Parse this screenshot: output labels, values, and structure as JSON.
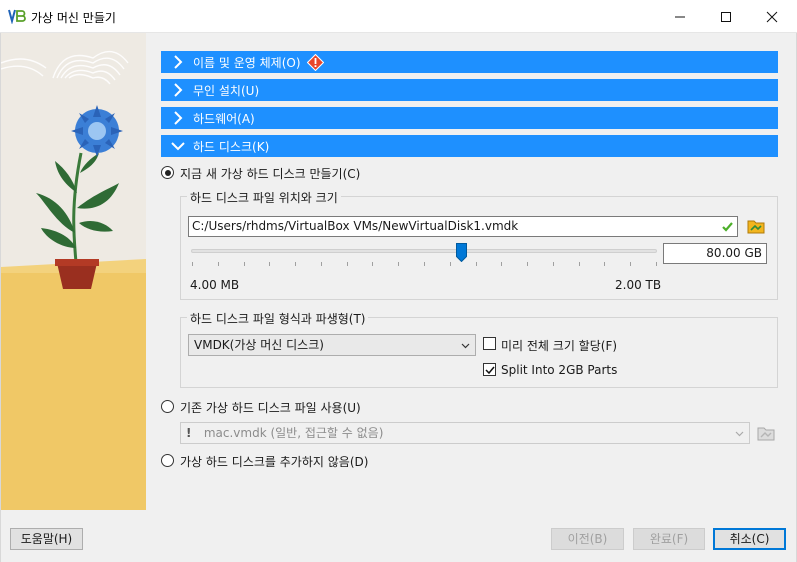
{
  "window": {
    "title": "가상 머신 만들기",
    "minimize_label": "Minimize",
    "maximize_label": "Maximize",
    "close_label": "Close"
  },
  "sections": [
    {
      "label": "이름 및 운영 체제(O)",
      "expanded": false,
      "warning": true
    },
    {
      "label": "무인 설치(U)",
      "expanded": false,
      "warning": false
    },
    {
      "label": "하드웨어(A)",
      "expanded": false,
      "warning": false
    },
    {
      "label": "하드 디스크(K)",
      "expanded": true,
      "warning": false
    }
  ],
  "disk": {
    "option_create": "지금 새 가상 하드 디스크 만들기(C)",
    "location_group": "하드 디스크 파일 위치와 크기",
    "path_value": "C:/Users/rhdms/VirtualBox VMs/NewVirtualDisk1.vmdk",
    "size_value": "80.00 GB",
    "size_fraction": 0.58,
    "slider_min_label": "4.00 MB",
    "slider_max_label": "2.00 TB",
    "format_group": "하드 디스크 파일 형식과 파생형(T)",
    "format_selected": "VMDK(가상 머신 디스크)",
    "preallocate_label": "미리 전체 크기 할당(F)",
    "preallocate_checked": false,
    "split_label": "Split Into 2GB Parts",
    "split_checked": true,
    "option_existing": "기존 가상 하드 디스크 파일 사용(U)",
    "existing_file_value": "mac.vmdk (일반, 접근할 수 없음)",
    "existing_file_badge": "!",
    "option_none": "가상 하드 디스크를 추가하지 않음(D)"
  },
  "footer": {
    "help_label": "도움말(H)",
    "back_label": "이전(B)",
    "finish_label": "완료(F)",
    "cancel_label": "취소(C)"
  },
  "colors": {
    "section_header": "#1e90ff",
    "accent": "#0078d7",
    "warning": "#e8462b",
    "art_yellow": "#f0c866"
  }
}
